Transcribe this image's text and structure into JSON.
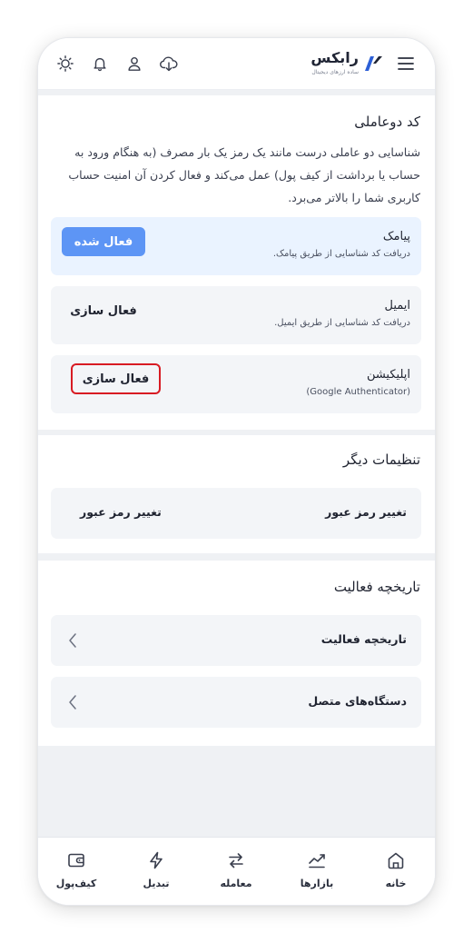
{
  "header": {
    "brand": "رابکس",
    "tagline": "ساده ارزهای دیجیتال",
    "icons": [
      "menu-icon",
      "download-icon",
      "user-icon",
      "bell-icon",
      "sun-icon"
    ]
  },
  "two_factor": {
    "title": "کد دوعاملی",
    "description": "شناسایی دو عاملی درست مانند یک رمز یک بار مصرف (به هنگام ورود به حساب یا برداشت از کیف پول) عمل می‌کند و فعال کردن آن امنیت حساب کاربری شما را بالاتر می‌برد.",
    "methods": [
      {
        "title": "پیامک",
        "subtitle": "دریافت کد شناسایی از طریق پیامک.",
        "button": "فعال شده",
        "active": true
      },
      {
        "title": "ایمیل",
        "subtitle": "دریافت کد شناسایی از طریق ایمیل.",
        "button": "فعال سازی",
        "active": false
      },
      {
        "title": "اپلیکیشن",
        "subtitle": "(Google Authenticator)",
        "button": "فعال سازی",
        "active": false
      }
    ]
  },
  "other_settings": {
    "title": "تنظیمات دیگر",
    "row_label": "تغییر رمز عبور",
    "row_action": "تغییر رمز عبور"
  },
  "activity": {
    "title": "تاریخچه فعالیت",
    "rows": [
      "تاریخچه فعالیت",
      "دستگاه‌های متصل"
    ]
  },
  "nav": {
    "items": [
      {
        "label": "خانه",
        "icon": "home-icon"
      },
      {
        "label": "بازارها",
        "icon": "chart-icon"
      },
      {
        "label": "معامله",
        "icon": "swap-icon"
      },
      {
        "label": "تبدیل",
        "icon": "lightning-icon"
      },
      {
        "label": "کیف‌پول",
        "icon": "wallet-icon"
      }
    ]
  },
  "colors": {
    "accent": "#5d95f5",
    "highlight": "#d81b23",
    "background": "#eff1f4"
  }
}
